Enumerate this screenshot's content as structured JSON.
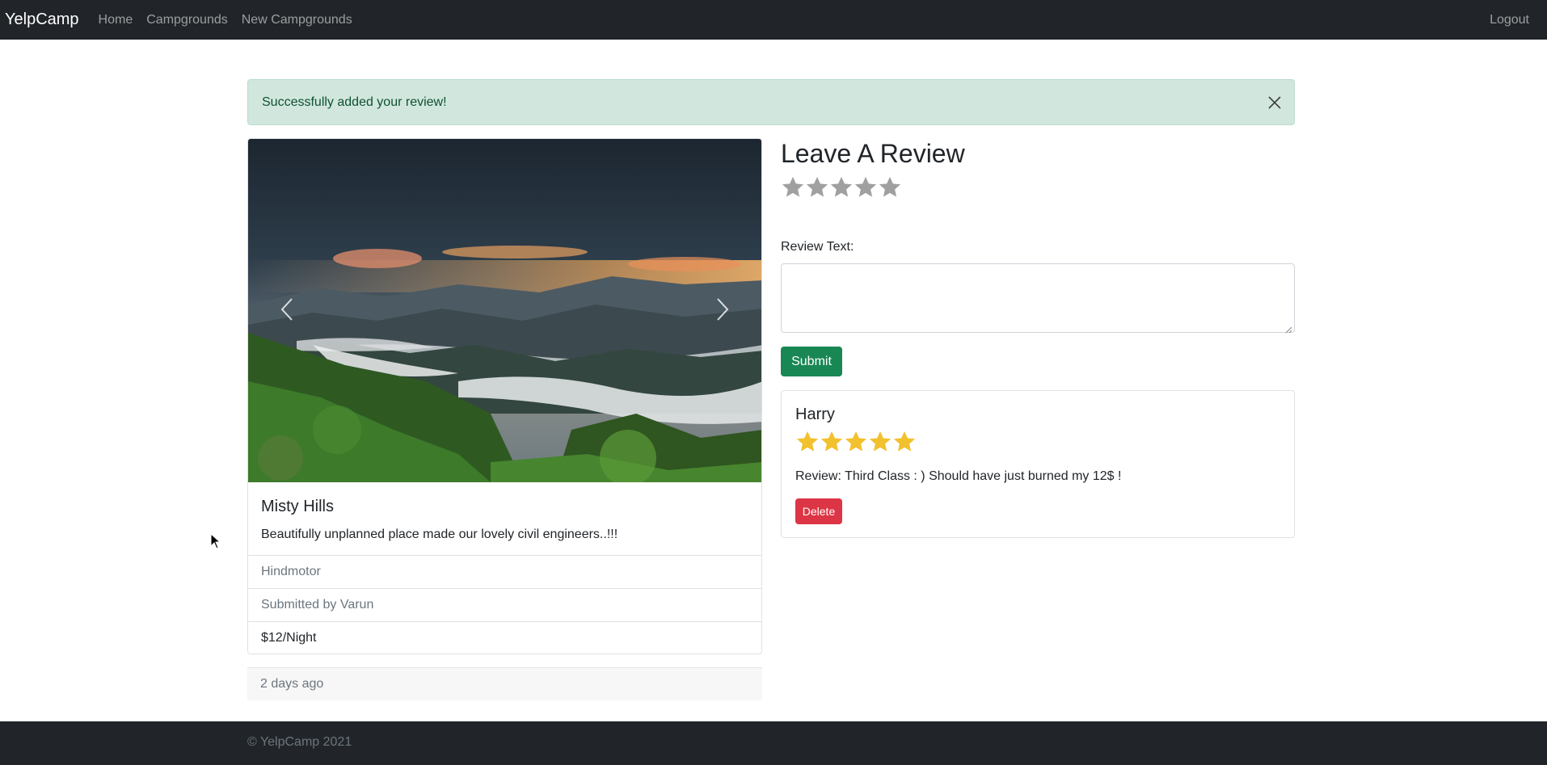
{
  "navbar": {
    "brand": "YelpCamp",
    "links": [
      "Home",
      "Campgrounds",
      "New Campgrounds"
    ],
    "logout": "Logout"
  },
  "flash": {
    "message": "Successfully added your review!",
    "close_icon": "close-icon"
  },
  "campground": {
    "title": "Misty Hills",
    "description": "Beautifully unplanned place made our lovely civil engineers..!!!",
    "location": "Hindmotor",
    "submitted_by": "Submitted by Varun",
    "price": "$12/Night",
    "posted": "2 days ago",
    "image_description": "misty mountain valley landscape at sunset"
  },
  "review_form": {
    "heading": "Leave A Review",
    "rating_max": 5,
    "rating_selected": 0,
    "text_label": "Review Text:",
    "text_value": "",
    "submit_label": "Submit"
  },
  "reviews": [
    {
      "author": "Harry",
      "rating": 5,
      "text": "Review: Third Class : ) Should have just burned my 12$ !",
      "delete_label": "Delete"
    }
  ],
  "footer": {
    "text": "© YelpCamp 2021"
  },
  "colors": {
    "navbar": "#212529",
    "flash_bg": "#d1e7dd",
    "flash_text": "#0f5132",
    "submit": "#198754",
    "delete": "#dc3545",
    "star_filled": "#f2c12e",
    "star_empty": "#a0a0a0"
  }
}
